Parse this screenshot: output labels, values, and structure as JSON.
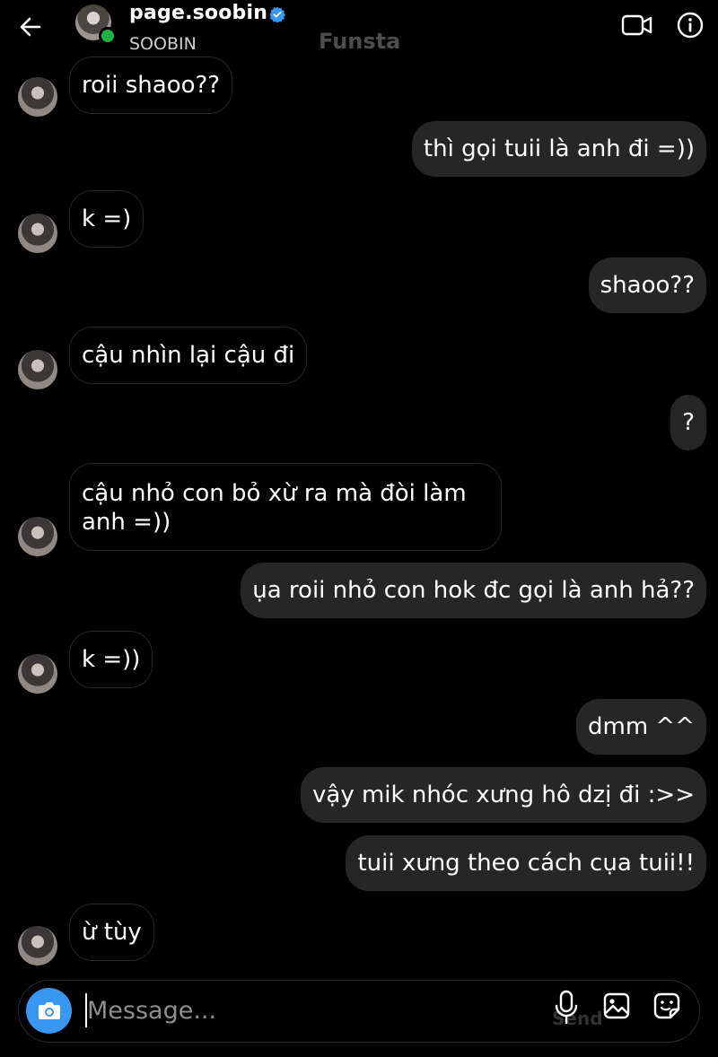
{
  "header": {
    "username": "page.soobin",
    "subname": "SOOBIN",
    "watermark": "Funsta"
  },
  "messages": [
    {
      "dir": "in",
      "text": "roii shaoo??"
    },
    {
      "dir": "out",
      "text": "thì gọi tuii là anh đi =))"
    },
    {
      "dir": "in",
      "text": "k =)"
    },
    {
      "dir": "out",
      "text": "shaoo??"
    },
    {
      "dir": "in",
      "text": "cậu nhìn lại cậu đi"
    },
    {
      "dir": "out",
      "text": "?"
    },
    {
      "dir": "in",
      "text": "cậu nhỏ con bỏ xừ ra mà đòi làm anh =))"
    },
    {
      "dir": "out",
      "text": "ụa roii nhỏ con hok đc gọi là anh hả??"
    },
    {
      "dir": "in",
      "text": "k =))"
    },
    {
      "dir": "out",
      "text": "dmm ^^"
    },
    {
      "dir": "out",
      "text": "vậy mik nhóc xưng hô dzị đi :>>"
    },
    {
      "dir": "out",
      "text": "tuii xưng theo cách cụa tuii!!"
    },
    {
      "dir": "in",
      "text": "ừ tùy"
    }
  ],
  "composer": {
    "placeholder": "Message...",
    "send_ghost": "Send"
  },
  "colors": {
    "background": "#000000",
    "outgoing_bubble": "#262626",
    "accent_camera": "#3897f0",
    "online_dot": "#1fb141",
    "verified": "#3897f0"
  },
  "icons": [
    "back-arrow-icon",
    "verified-badge-icon",
    "video-call-icon",
    "info-icon",
    "camera-icon",
    "microphone-icon",
    "gallery-icon",
    "sticker-icon"
  ]
}
